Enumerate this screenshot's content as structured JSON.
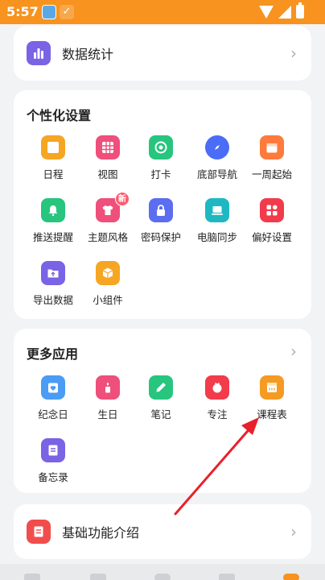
{
  "status_bar": {
    "time": "5:57"
  },
  "data_stats": {
    "label": "数据统计",
    "icon": "bar-chart-icon",
    "color": "#7b63e6"
  },
  "personalize": {
    "title": "个性化设置",
    "items": [
      {
        "label": "日程",
        "icon": "schedule-icon",
        "color": "#f5a623"
      },
      {
        "label": "视图",
        "icon": "view-grid-icon",
        "color": "#ef4f7b"
      },
      {
        "label": "打卡",
        "icon": "checkin-icon",
        "color": "#27c57e"
      },
      {
        "label": "底部导航",
        "icon": "compass-icon",
        "color": "#4a6cf7"
      },
      {
        "label": "一周起始",
        "icon": "calendar-icon",
        "color": "#ff7a3d"
      },
      {
        "label": "推送提醒",
        "icon": "bell-icon",
        "color": "#27c57e"
      },
      {
        "label": "主题风格",
        "icon": "shirt-icon",
        "color": "#ef4f7b",
        "badge": "新"
      },
      {
        "label": "密码保护",
        "icon": "lock-icon",
        "color": "#5b6df0"
      },
      {
        "label": "电脑同步",
        "icon": "laptop-icon",
        "color": "#1fb8c2"
      },
      {
        "label": "偏好设置",
        "icon": "apps-icon",
        "color": "#f23b4b"
      },
      {
        "label": "导出数据",
        "icon": "export-folder-icon",
        "color": "#7b63e6"
      },
      {
        "label": "小组件",
        "icon": "widget-cube-icon",
        "color": "#f5a623"
      }
    ]
  },
  "more_apps": {
    "title": "更多应用",
    "items": [
      {
        "label": "纪念日",
        "icon": "heart-calendar-icon",
        "color": "#4a9cf5"
      },
      {
        "label": "生日",
        "icon": "cake-icon",
        "color": "#ef4f7b"
      },
      {
        "label": "笔记",
        "icon": "pencil-icon",
        "color": "#27c57e"
      },
      {
        "label": "专注",
        "icon": "tomato-clock-icon",
        "color": "#f23b4b"
      },
      {
        "label": "课程表",
        "icon": "timetable-icon",
        "color": "#f59a23"
      },
      {
        "label": "备忘录",
        "icon": "memo-icon",
        "color": "#7b63e6"
      }
    ]
  },
  "basics": {
    "label": "基础功能介绍",
    "icon": "document-icon",
    "color": "#f24d4d"
  }
}
